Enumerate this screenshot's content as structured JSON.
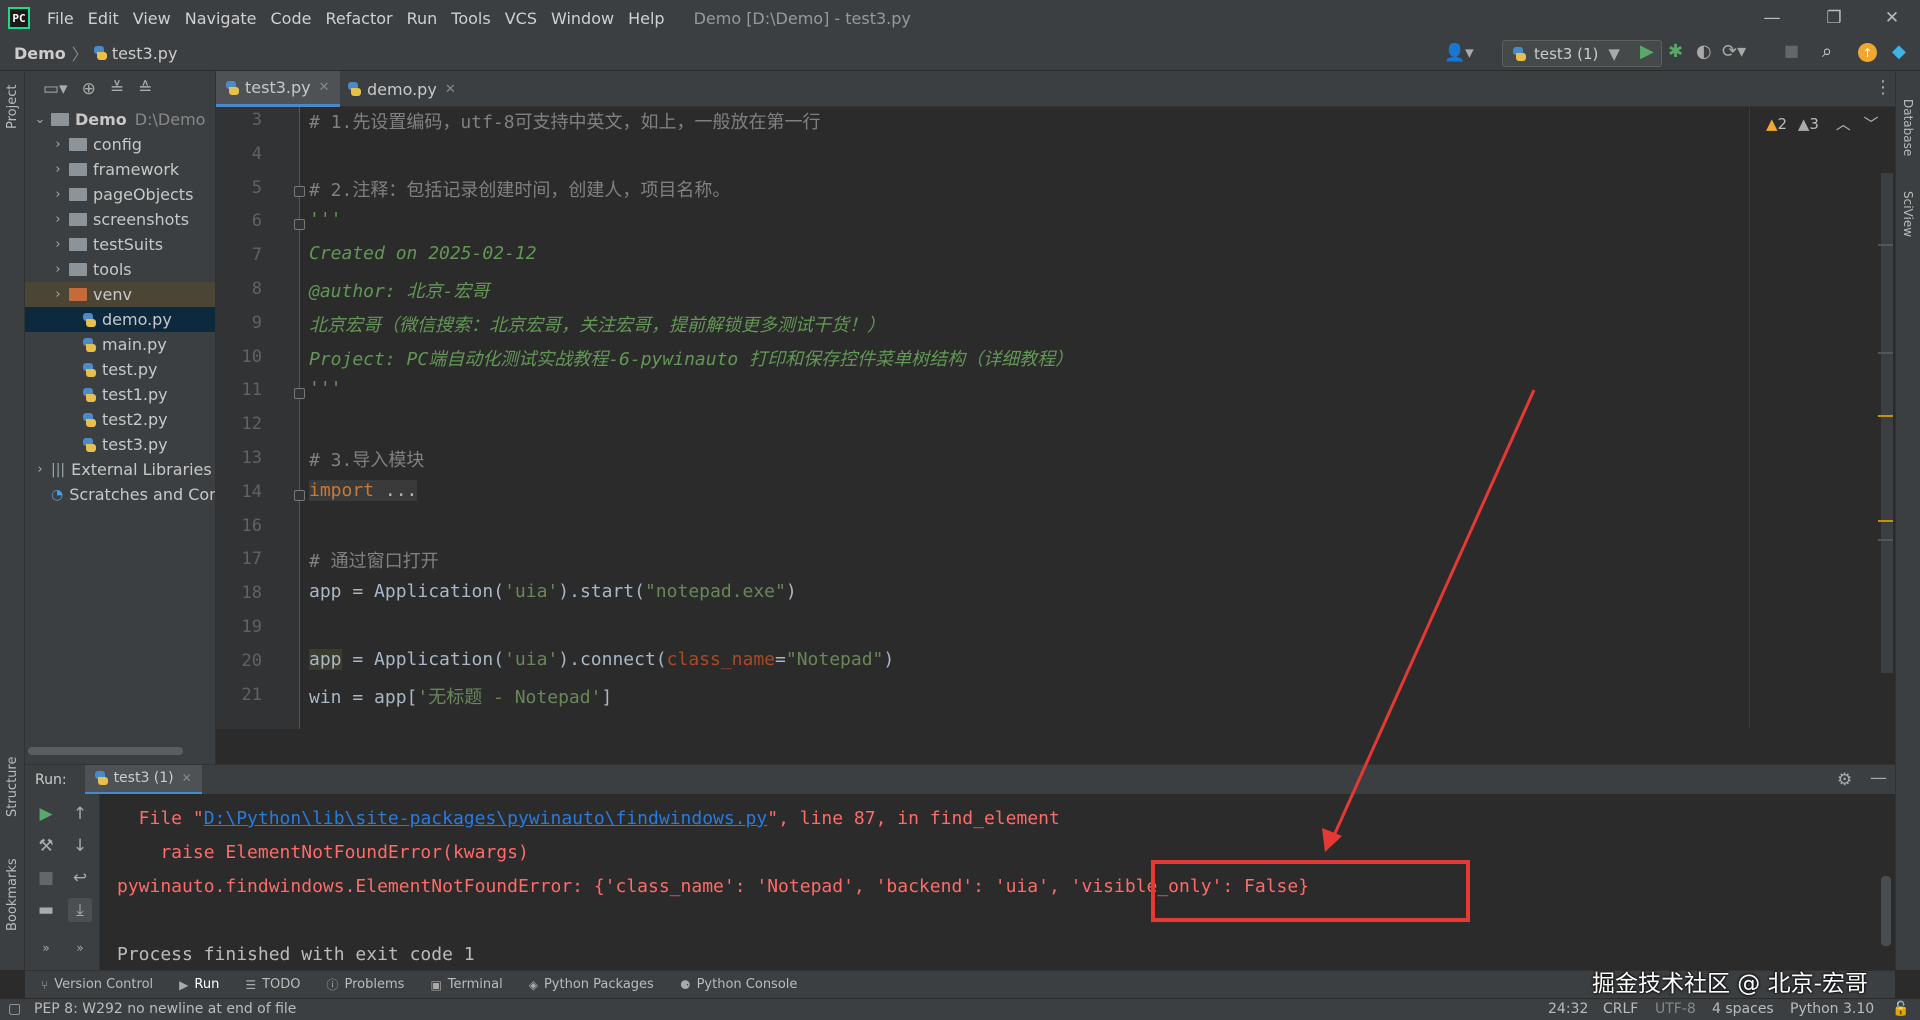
{
  "window": {
    "title": "Demo [D:\\Demo] - test3.py",
    "minimize": "—",
    "restore": "❐",
    "close": "✕"
  },
  "menu": [
    "File",
    "Edit",
    "View",
    "Navigate",
    "Code",
    "Refactor",
    "Run",
    "Tools",
    "VCS",
    "Window",
    "Help"
  ],
  "breadcrumb": {
    "project": "Demo",
    "file": "test3.py"
  },
  "run_config": "test3 (1)",
  "project_tree": {
    "root": {
      "name": "Demo",
      "path": "D:\\Demo"
    },
    "items": [
      {
        "label": "config",
        "type": "folder"
      },
      {
        "label": "framework",
        "type": "folder"
      },
      {
        "label": "pageObjects",
        "type": "folder"
      },
      {
        "label": "screenshots",
        "type": "folder"
      },
      {
        "label": "testSuits",
        "type": "folder"
      },
      {
        "label": "tools",
        "type": "folder"
      },
      {
        "label": "venv",
        "type": "folder-excluded"
      },
      {
        "label": "demo.py",
        "type": "file",
        "selected": true
      },
      {
        "label": "main.py",
        "type": "file"
      },
      {
        "label": "test.py",
        "type": "file"
      },
      {
        "label": "test1.py",
        "type": "file"
      },
      {
        "label": "test2.py",
        "type": "file"
      },
      {
        "label": "test3.py",
        "type": "file"
      }
    ],
    "external": "External Libraries",
    "scratches": "Scratches and Con"
  },
  "tabs": [
    {
      "label": "test3.py",
      "active": true
    },
    {
      "label": "demo.py",
      "active": false
    }
  ],
  "inspections": {
    "warnings": "2",
    "weak_warnings": "3"
  },
  "code_lines": [
    {
      "n": "3",
      "text": "# 1.先设置编码，utf-8可支持中英文，如上，一般放在第一行"
    },
    {
      "n": "4",
      "text": ""
    },
    {
      "n": "5",
      "text": "# 2.注释：包括记录创建时间，创建人，项目名称。"
    },
    {
      "n": "6",
      "text": "'''"
    },
    {
      "n": "7",
      "text": "Created on 2025-02-12"
    },
    {
      "n": "8",
      "text": "@author: 北京-宏哥"
    },
    {
      "n": "9",
      "text": "北京宏哥（微信搜索：北京宏哥，关注宏哥，提前解锁更多测试干货！）"
    },
    {
      "n": "10",
      "text": "Project: PC端自动化测试实战教程-6-pywinauto 打印和保存控件菜单树结构（详细教程）"
    },
    {
      "n": "11",
      "text": "'''"
    },
    {
      "n": "12",
      "text": ""
    },
    {
      "n": "13",
      "text": "# 3.导入模块"
    },
    {
      "n": "14",
      "text": "import ..."
    },
    {
      "n": "16",
      "text": ""
    },
    {
      "n": "17",
      "text": "# 通过窗口打开"
    },
    {
      "n": "18",
      "text": ""
    },
    {
      "n": "19",
      "text": ""
    },
    {
      "n": "20",
      "text": ""
    },
    {
      "n": "21",
      "text": ""
    }
  ],
  "code_tokens": {
    "l18": [
      "app = Application(",
      "'uia'",
      ").start(",
      "\"notepad.exe\"",
      ")"
    ],
    "l20": [
      "app",
      " = Application(",
      "'uia'",
      ").connect(",
      "class_name",
      "=",
      "\"Notepad\"",
      ")"
    ],
    "l21": [
      "win = app[",
      "'无标题 - Notepad'",
      "]"
    ]
  },
  "run_panel": {
    "label": "Run:",
    "tab": "test3 (1)",
    "console": {
      "line1_pre": "  File \"",
      "line1_link": "D:\\Python\\lib\\site-packages\\pywinauto\\findwindows.py",
      "line1_post": "\", line 87, in find_element",
      "line2": "    raise ElementNotFoundError(kwargs)",
      "line3": "pywinauto.findwindows.ElementNotFoundError: {'class_name': 'Notepad', 'backend': 'uia', 'visible_only': False}",
      "line4": "Process finished with exit code 1"
    }
  },
  "tool_windows": [
    "Version Control",
    "Run",
    "TODO",
    "Problems",
    "Terminal",
    "Python Packages",
    "Python Console"
  ],
  "left_strip": {
    "project": "Project",
    "structure": "Structure",
    "bookmarks": "Bookmarks"
  },
  "right_strip": {
    "database": "Database",
    "sciview": "SciView"
  },
  "status": {
    "message": "PEP 8: W292 no newline at end of file",
    "position": "24:32",
    "line_sep": "CRLF",
    "encoding": "UTF-8",
    "indent": "4 spaces",
    "interpreter": "Python 3.10"
  },
  "watermark": "掘金技术社区 @ 北京-宏哥",
  "colors": {
    "annotation": "#e53935",
    "accent": "#4a88c7"
  }
}
